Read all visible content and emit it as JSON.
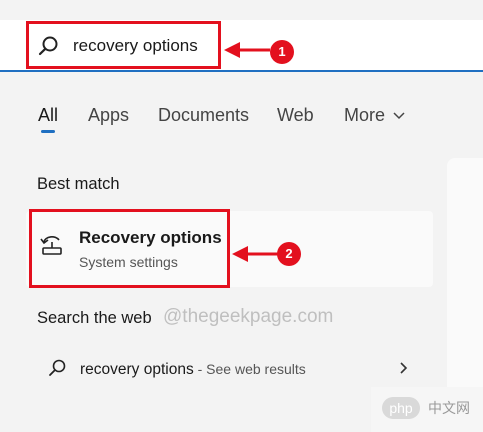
{
  "search": {
    "query": "recovery options",
    "icon": "search-icon"
  },
  "annotations": {
    "badge1": "1",
    "badge2": "2",
    "color": "#e3101e"
  },
  "tabs": [
    {
      "label": "All",
      "active": true
    },
    {
      "label": "Apps"
    },
    {
      "label": "Documents"
    },
    {
      "label": "Web"
    },
    {
      "label": "More"
    }
  ],
  "sections": {
    "best_match": "Best match",
    "search_web": "Search the web"
  },
  "best_match": {
    "title": "Recovery options",
    "subtitle": "System settings",
    "icon": "recovery-icon"
  },
  "web_result": {
    "query": "recovery options",
    "suffix": " - See web results"
  },
  "watermark": {
    "text": "@thegeekpage.com",
    "logo": "php",
    "cn": "中文网"
  },
  "colors": {
    "accent": "#1f6fc1",
    "background": "#f3f3f3",
    "highlight": "#e3101e"
  }
}
